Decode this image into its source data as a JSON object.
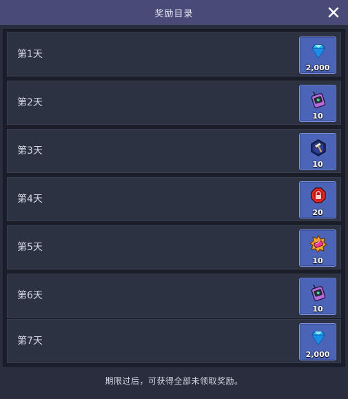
{
  "dialog": {
    "title": "奖励目录",
    "close_icon": "close-icon",
    "footer": "期限过后，可获得全部未领取奖励。"
  },
  "rewards": [
    {
      "day": "第1天",
      "icon": "diamond-icon",
      "qty": "2,000"
    },
    {
      "day": "第2天",
      "icon": "radio-device-icon",
      "qty": "10"
    },
    {
      "day": "第3天",
      "icon": "hammer-hexagon-icon",
      "qty": "10"
    },
    {
      "day": "第4天",
      "icon": "lock-octagon-icon",
      "qty": "20"
    },
    {
      "day": "第5天",
      "icon": "ticket-badge-icon",
      "qty": "10"
    },
    {
      "day": "第6天",
      "icon": "radio-device-icon",
      "qty": "10"
    },
    {
      "day": "第7天",
      "icon": "diamond-icon",
      "qty": "2,000"
    }
  ],
  "colors": {
    "titlebar": "#4a4a78",
    "row_bg": "#2c3242",
    "item_bg": "#4b64b8"
  }
}
